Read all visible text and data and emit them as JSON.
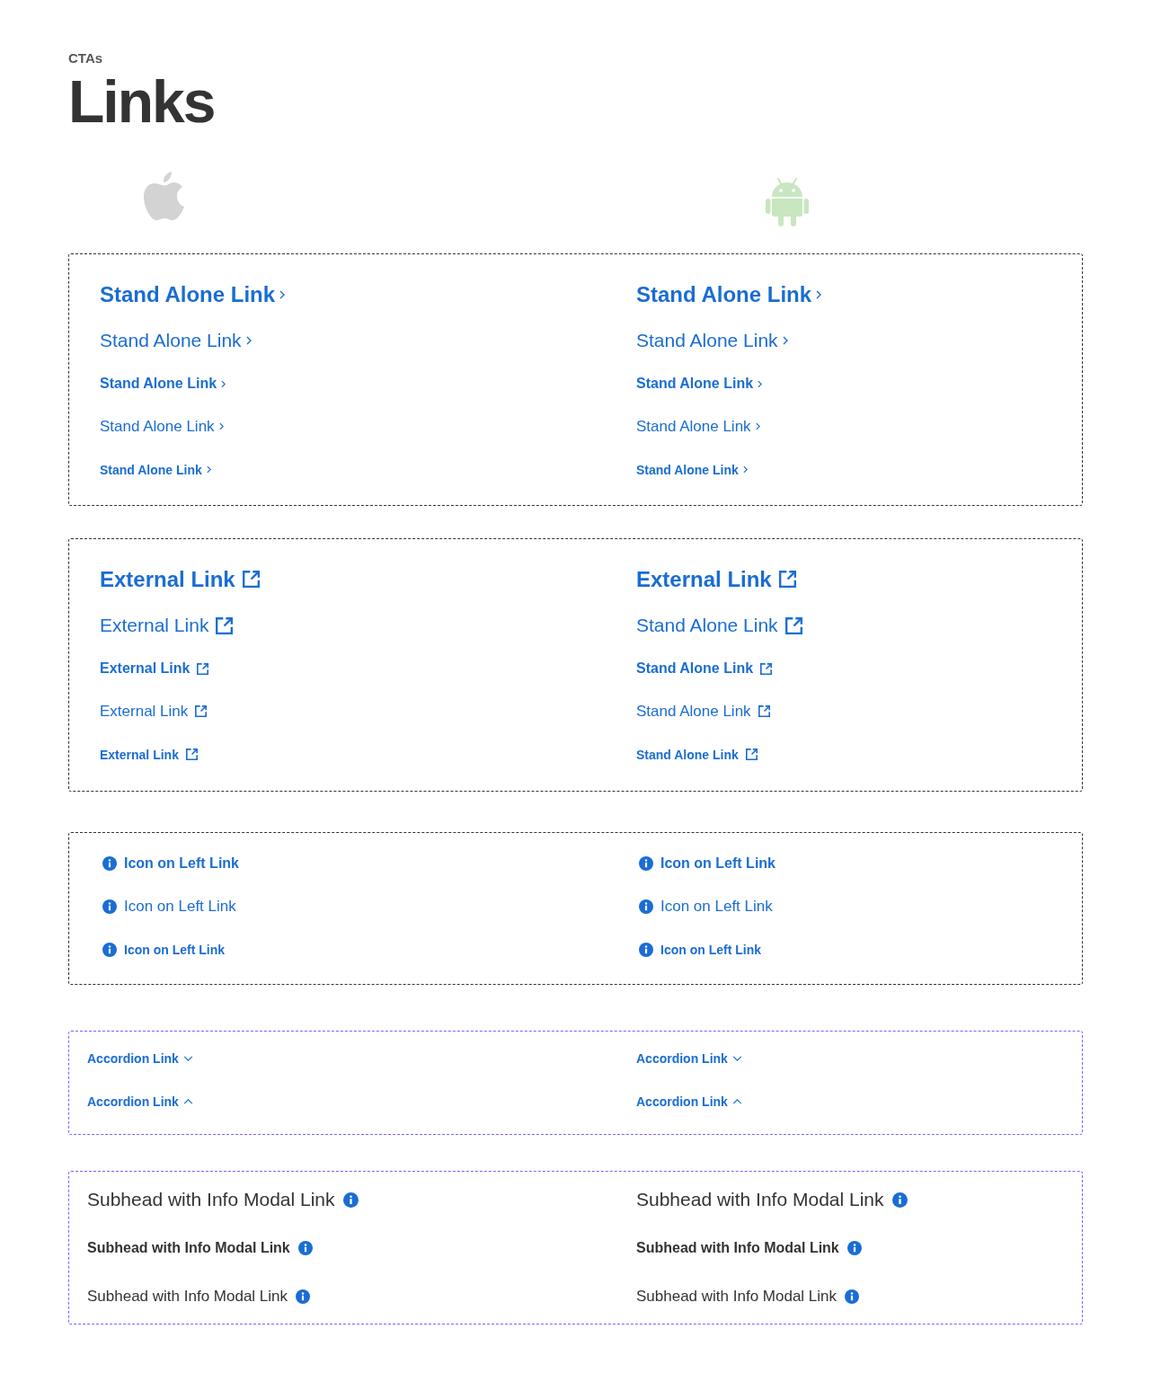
{
  "header": {
    "eyebrow": "CTAs",
    "title": "Links"
  },
  "sections": [
    {
      "kind": "chevron",
      "color": "#333333",
      "columns": [
        {
          "links": [
            {
              "text": "Stand Alone Link",
              "kind": "title"
            },
            {
              "text": "Stand Alone Link",
              "kind": "headline"
            },
            {
              "text": "Stand Alone Link",
              "kind": "strong"
            },
            {
              "text": "Stand Alone Link",
              "kind": "body"
            },
            {
              "text": "Stand Alone Link",
              "kind": "caption"
            }
          ]
        },
        {
          "links": [
            {
              "text": "Stand Alone Link",
              "kind": "title"
            },
            {
              "text": "Stand Alone Link",
              "kind": "headline"
            },
            {
              "text": "Stand Alone Link",
              "kind": "strong"
            },
            {
              "text": "Stand Alone Link",
              "kind": "body"
            },
            {
              "text": "Stand Alone Link",
              "kind": "caption"
            }
          ]
        }
      ]
    },
    {
      "kind": "external",
      "color": "#333333",
      "columns": [
        {
          "links": [
            {
              "text": "External Link",
              "kind": "title"
            },
            {
              "text": "External Link",
              "kind": "headline"
            },
            {
              "text": "External Link",
              "kind": "strong"
            },
            {
              "text": "External Link",
              "kind": "body"
            },
            {
              "text": "External Link",
              "kind": "caption"
            }
          ]
        },
        {
          "links": [
            {
              "text": "External Link",
              "kind": "title"
            },
            {
              "text": "Stand Alone Link",
              "kind": "headline"
            },
            {
              "text": "Stand Alone Link",
              "kind": "strong"
            },
            {
              "text": "Stand Alone Link",
              "kind": "body"
            },
            {
              "text": "Stand Alone Link",
              "kind": "caption"
            }
          ]
        }
      ]
    },
    {
      "kind": "info-left",
      "color": "#333333",
      "columns": [
        {
          "links": [
            {
              "text": "Icon on Left Link",
              "kind": "strong"
            },
            {
              "text": "Icon on Left Link",
              "kind": "body"
            },
            {
              "text": "Icon on Left Link",
              "kind": "caption"
            }
          ]
        },
        {
          "links": [
            {
              "text": "Icon on Left Link",
              "kind": "strong"
            },
            {
              "text": "Icon on Left Link",
              "kind": "body"
            },
            {
              "text": "Icon on Left Link",
              "kind": "caption"
            }
          ]
        }
      ]
    },
    {
      "kind": "accordion",
      "color": "#7b61ff",
      "columns": [
        {
          "links": [
            {
              "text": "Accordion Link",
              "kind": "caption",
              "expanded": false
            },
            {
              "text": "Accordion Link",
              "kind": "caption",
              "expanded": true
            }
          ]
        },
        {
          "links": [
            {
              "text": "Accordion Link",
              "kind": "caption",
              "expanded": false
            },
            {
              "text": "Accordion Link",
              "kind": "caption",
              "expanded": true
            }
          ]
        }
      ]
    },
    {
      "kind": "subhead",
      "color": "#7b61ff",
      "columns": [
        {
          "links": [
            {
              "text": "Subhead with Info Modal Link",
              "kind": "headline"
            },
            {
              "text": "Subhead with Info Modal Link",
              "kind": "strong"
            },
            {
              "text": "Subhead with Info Modal Link",
              "kind": "body"
            }
          ]
        },
        {
          "links": [
            {
              "text": "Subhead with Info Modal Link",
              "kind": "headline"
            },
            {
              "text": "Subhead with Info Modal Link",
              "kind": "strong"
            },
            {
              "text": "Subhead with Info Modal Link",
              "kind": "body"
            }
          ]
        }
      ]
    }
  ]
}
